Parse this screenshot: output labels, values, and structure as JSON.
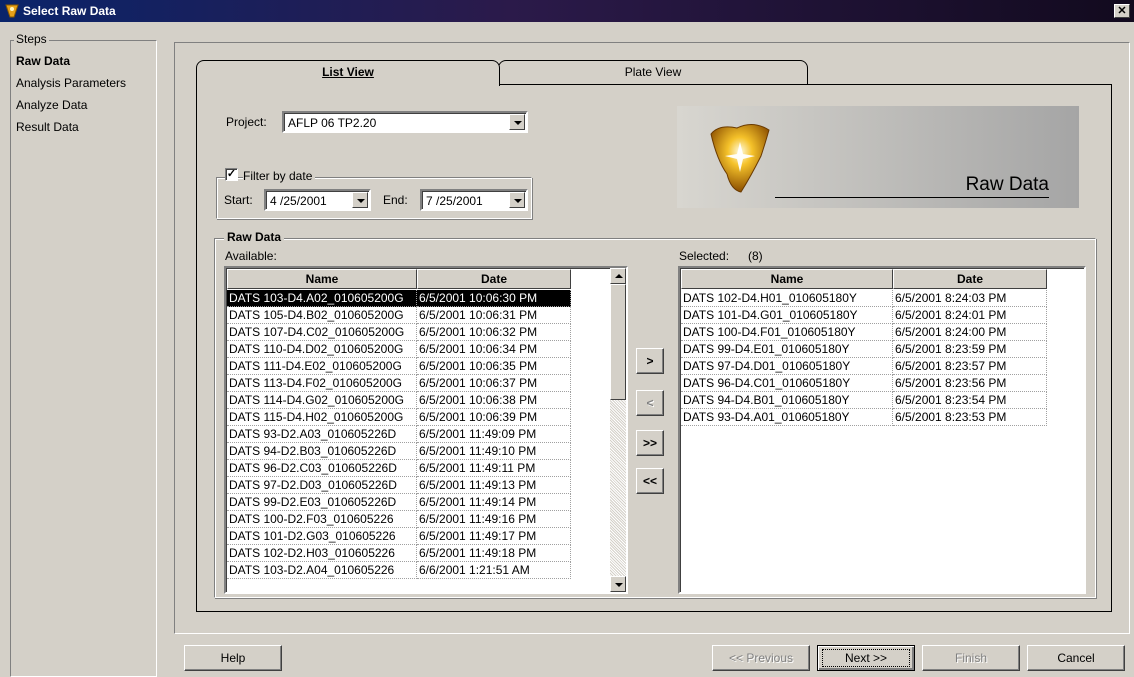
{
  "window": {
    "title": "Select Raw Data",
    "close_glyph": "✕"
  },
  "steps": {
    "legend": "Steps",
    "items": [
      {
        "label": "Raw Data",
        "active": true
      },
      {
        "label": "Analysis Parameters",
        "active": false
      },
      {
        "label": "Analyze Data",
        "active": false
      },
      {
        "label": "Result Data",
        "active": false
      }
    ]
  },
  "tabs": [
    {
      "label": "List View",
      "active": true
    },
    {
      "label": "Plate View",
      "active": false
    }
  ],
  "project": {
    "label": "Project:",
    "value": "AFLP 06 TP2.20"
  },
  "filter": {
    "checkbox_label": "Filter by date",
    "checked": true,
    "start_label": "Start:",
    "start_value": "4 /25/2001",
    "end_label": "End:",
    "end_value": "7 /25/2001"
  },
  "banner": {
    "title": "Raw Data",
    "icon": "golden-star-burst-icon"
  },
  "raw_data": {
    "legend": "Raw Data",
    "available_label": "Available:",
    "selected_label": "Selected:",
    "selected_count": "(8)",
    "columns": [
      "Name",
      "Date"
    ],
    "available": [
      [
        "DATS 103-D4.A02_010605200G",
        "6/5/2001 10:06:30 PM"
      ],
      [
        "DATS 105-D4.B02_010605200G",
        "6/5/2001 10:06:31 PM"
      ],
      [
        "DATS 107-D4.C02_010605200G",
        "6/5/2001 10:06:32 PM"
      ],
      [
        "DATS 110-D4.D02_010605200G",
        "6/5/2001 10:06:34 PM"
      ],
      [
        "DATS 111-D4.E02_010605200G",
        "6/5/2001 10:06:35 PM"
      ],
      [
        "DATS 113-D4.F02_010605200G",
        "6/5/2001 10:06:37 PM"
      ],
      [
        "DATS 114-D4.G02_010605200G",
        "6/5/2001 10:06:38 PM"
      ],
      [
        "DATS 115-D4.H02_010605200G",
        "6/5/2001 10:06:39 PM"
      ],
      [
        "DATS 93-D2.A03_010605226D",
        "6/5/2001 11:49:09 PM"
      ],
      [
        "DATS 94-D2.B03_010605226D",
        "6/5/2001 11:49:10 PM"
      ],
      [
        "DATS 96-D2.C03_010605226D",
        "6/5/2001 11:49:11 PM"
      ],
      [
        "DATS 97-D2.D03_010605226D",
        "6/5/2001 11:49:13 PM"
      ],
      [
        "DATS 99-D2.E03_010605226D",
        "6/5/2001 11:49:14 PM"
      ],
      [
        "DATS 100-D2.F03_010605226",
        "6/5/2001 11:49:16 PM"
      ],
      [
        "DATS 101-D2.G03_010605226",
        "6/5/2001 11:49:17 PM"
      ],
      [
        "DATS 102-D2.H03_010605226",
        "6/5/2001 11:49:18 PM"
      ],
      [
        "DATS 103-D2.A04_010605226",
        "6/6/2001 1:21:51 AM"
      ]
    ],
    "selected": [
      [
        "DATS 102-D4.H01_010605180Y",
        "6/5/2001 8:24:03 PM"
      ],
      [
        "DATS 101-D4.G01_010605180Y",
        "6/5/2001 8:24:01 PM"
      ],
      [
        "DATS 100-D4.F01_010605180Y",
        "6/5/2001 8:24:00 PM"
      ],
      [
        "DATS 99-D4.E01_010605180Y",
        "6/5/2001 8:23:59 PM"
      ],
      [
        "DATS 97-D4.D01_010605180Y",
        "6/5/2001 8:23:57 PM"
      ],
      [
        "DATS 96-D4.C01_010605180Y",
        "6/5/2001 8:23:56 PM"
      ],
      [
        "DATS 94-D4.B01_010605180Y",
        "6/5/2001 8:23:54 PM"
      ],
      [
        "DATS 93-D4.A01_010605180Y",
        "6/5/2001 8:23:53 PM"
      ]
    ],
    "transfer_buttons": [
      ">",
      "<",
      ">>",
      "<<"
    ]
  },
  "footer": {
    "help": "Help",
    "previous": "<< Previous",
    "next": "Next >>",
    "finish": "Finish",
    "cancel": "Cancel"
  }
}
